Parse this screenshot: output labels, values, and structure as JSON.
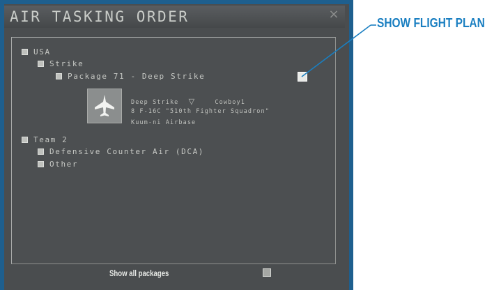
{
  "window": {
    "title": "AIR TASKING ORDER",
    "close_glyph": "×"
  },
  "tree": {
    "side1": "USA",
    "mission_type": "Strike",
    "package": "Package 71 - Deep Strike",
    "flight": {
      "line1_mission": "Deep Strike",
      "line1_marker": "▽",
      "line1_callsign": "Cowboy1",
      "line2": "8 F-16C \"510th Fighter Squadron\"",
      "line3": "Kuum-ni Airbase"
    },
    "side2": "Team 2",
    "dca": "Defensive Counter Air (DCA)",
    "other": "Other"
  },
  "footer": {
    "show_all_label": "Show all packages"
  },
  "callout": {
    "label": "SHOW FLIGHT PLAN"
  },
  "icons": {
    "aircraft": "jet-fighter-icon",
    "close": "close-icon"
  },
  "colors": {
    "frame": "#1e5f8e",
    "panel": "#4a4d4f",
    "text": "#c6c8c4",
    "callout": "#1a7fc1"
  }
}
